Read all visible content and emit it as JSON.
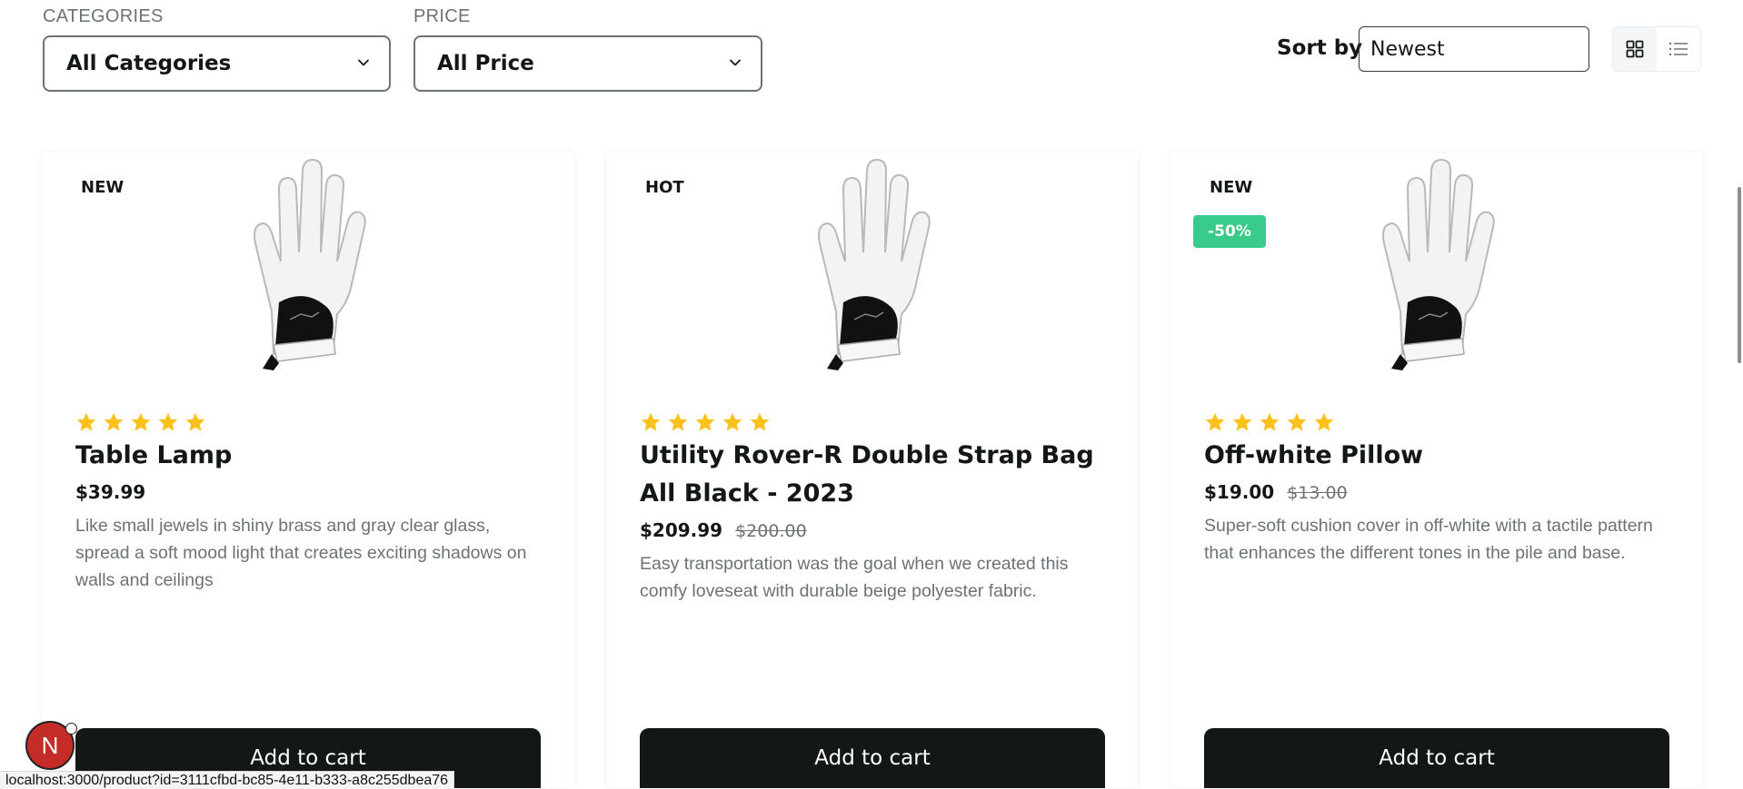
{
  "filters": {
    "categories_label": "CATEGORIES",
    "categories_value": "All Categories",
    "price_label": "PRICE",
    "price_value": "All Price"
  },
  "sort": {
    "label": "Sort by",
    "value": "Newest"
  },
  "view": {
    "grid_icon": "grid-icon",
    "list_icon": "list-icon",
    "active": "grid"
  },
  "colors": {
    "star": "#fcc11b",
    "discount": "#38cb89",
    "button": "#141718"
  },
  "products": [
    {
      "badge": "NEW",
      "discount": "",
      "rating": 5,
      "title": "Table Lamp",
      "price": "$39.99",
      "old_price": "",
      "description": "Like small jewels in shiny brass and gray clear glass, spread a soft mood light that creates exciting shadows on walls and ceilings",
      "button": "Add to cart"
    },
    {
      "badge": "HOT",
      "discount": "",
      "rating": 5,
      "title": "Utility Rover-R Double Strap Bag All Black - 2023",
      "price": "$209.99",
      "old_price": "$200.00",
      "description": "Easy transportation was the goal when we created this comfy loveseat with durable beige polyester fabric.",
      "button": "Add to cart"
    },
    {
      "badge": "NEW",
      "discount": "-50%",
      "rating": 5,
      "title": "Off-white Pillow",
      "price": "$19.00",
      "old_price": "$13.00",
      "description": "Super-soft cushion cover in off-white with a tactile pattern that enhances the different tones in the pile and base.",
      "button": "Add to cart"
    }
  ],
  "status_bar": {
    "url": "localhost:3000/product?id=3111cfbd-bc85-4e11-b333-a8c255dbea76"
  },
  "dev_badge": {
    "letter": "N"
  }
}
